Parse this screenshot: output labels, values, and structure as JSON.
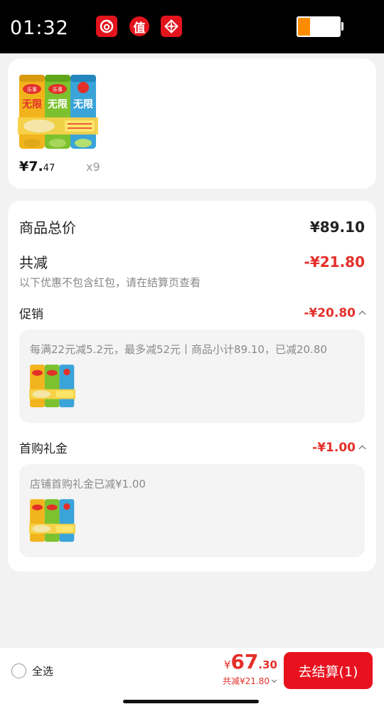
{
  "status_bar": {
    "time": "01:32",
    "app_icons": [
      "netease-music-icon",
      "smzdm-zhi-icon",
      "gift-knot-icon"
    ],
    "battery_level": 0.3,
    "zhi_glyph": "值"
  },
  "product": {
    "image": "lays-chips-three-can-pack",
    "pack_text_1": "乐事",
    "pack_text_2": "无限",
    "price_int": "¥7.",
    "price_dec": "47",
    "quantity": "x9"
  },
  "summary": {
    "total_label": "商品总价",
    "total_value": "¥89.10",
    "reduction_label": "共减",
    "reduction_value": "-¥21.80",
    "reduction_note": "以下优惠不包含红包，请在结算页查看",
    "promo": {
      "label": "促销",
      "value": "-¥20.80",
      "detail": "每满22元减5.2元，最多减52元丨商品小计89.10，已减20.80"
    },
    "first_purchase": {
      "label": "首购礼金",
      "value": "-¥1.00",
      "detail": "店铺首购礼金已减¥1.00"
    }
  },
  "bottom_bar": {
    "select_all_label": "全选",
    "total_currency": "¥",
    "total_int": "67",
    "total_dec": ".30",
    "saved_text": "共减¥21.80",
    "checkout_label": "去结算(1)"
  },
  "colors": {
    "accent_red": "#e4302a",
    "checkout_red": "#e8121f",
    "battery_orange": "#ff8c00"
  }
}
